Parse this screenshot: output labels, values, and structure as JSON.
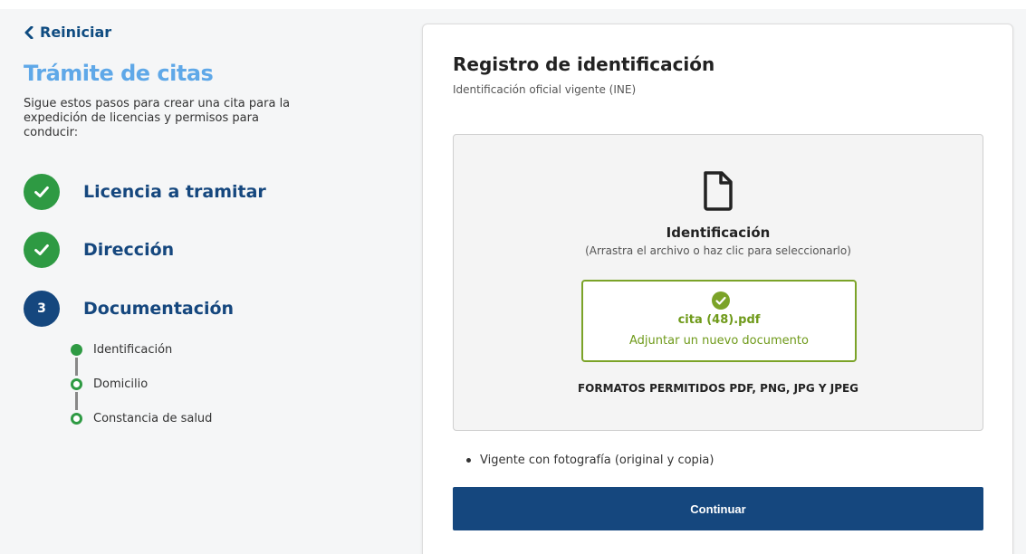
{
  "nav": {
    "back_label": "Reiniciar"
  },
  "sidebar": {
    "title": "Trámite de citas",
    "description": "Sigue estos pasos para crear una cita para la expedición de licencias y permisos para conducir:",
    "steps": [
      {
        "label": "Licencia a tramitar",
        "state": "done"
      },
      {
        "label": "Dirección",
        "state": "done"
      },
      {
        "number": "3",
        "label": "Documentación",
        "state": "current"
      }
    ],
    "substeps": [
      {
        "label": "Identificación",
        "state": "active"
      },
      {
        "label": "Domicilio",
        "state": "pending"
      },
      {
        "label": "Constancia de salud",
        "state": "pending"
      }
    ]
  },
  "main": {
    "title": "Registro de identificación",
    "subtitle": "Identificación oficial vigente (INE)",
    "dropzone": {
      "icon": "file-icon",
      "title": "Identificación",
      "hint": "(Arrastra el archivo o haz clic para seleccionarlo)",
      "uploaded_file": "cita (48).pdf",
      "replace_label": "Adjuntar un nuevo documento",
      "formats": "FORMATOS PERMITIDOS PDF, PNG, JPG Y JPEG"
    },
    "requirements": [
      "Vigente con fotografía (original y copia)"
    ],
    "continue_label": "Continuar"
  },
  "colors": {
    "primary": "#15477e",
    "success": "#2e9a43",
    "upload_ok": "#7ba328",
    "title_accent": "#5fa8e8"
  }
}
